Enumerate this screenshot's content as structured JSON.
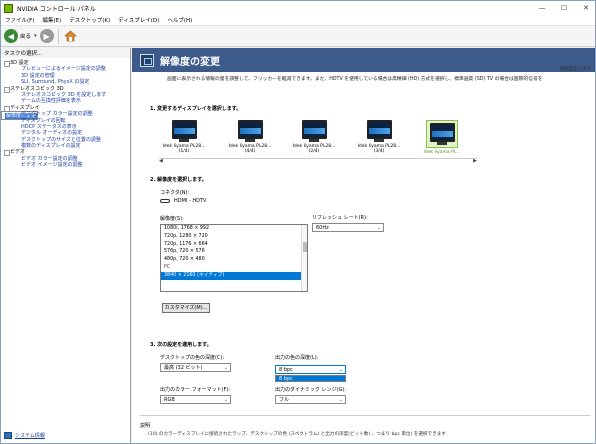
{
  "window": {
    "title": "NVIDIA コントロール パネル",
    "controls": [
      "—",
      "☐",
      "✕"
    ]
  },
  "menu": [
    "ファイル(F)",
    "編集(E)",
    "デスクトップ(K)",
    "ディスプレイ(D)",
    "ヘルプ(H)"
  ],
  "toolbar": {
    "back_label": "戻る"
  },
  "sidebar": {
    "header": "タスクの選択...",
    "categories": [
      {
        "label": "3D 設定",
        "items": [
          "プレビューによるイメージ設定の調整",
          "3D 設定の管理",
          "SLI, Surround, PhysX の設定"
        ]
      },
      {
        "label": "ステレオスコピック 3D",
        "items": [
          "ステレオスコピック 3D を設定します",
          "ゲームの互換性評価を表示"
        ]
      },
      {
        "label": "ディスプレイ",
        "items": [
          "解像度の変更",
          "デスクトップ カラー設定の調整",
          "ディスプレイの回転",
          "HDCP ステータスの表示",
          "デジタル オーディオの設定",
          "デスクトップのサイズと位置の調整",
          "複数のディスプレイの設定"
        ]
      },
      {
        "label": "ビデオ",
        "items": [
          "ビデオ カラー設定の調整",
          "ビデオ イメージ設定の調整"
        ]
      }
    ],
    "selected": "解像度の変更",
    "system_info": "システム情報"
  },
  "page": {
    "title": "解像度の変更",
    "restore": "初期設定に戻す",
    "description": "画面に表示される情報の量を調整して、フリッカーを軽減できます。また、HDTV を使用している場合は高精細 (HD) 方式を選択し、標準画質 (SD) TV の場合は国際的信号を",
    "step1": "1. 変更するディスプレイを選択します。",
    "monitors": [
      "Idek Iiyama PL28...\n(1/4)",
      "Idek Iiyama PL28...\n(4/4)",
      "Idek Iiyama PL28...\n(2/4)",
      "Idek Iiyama PL28...\n(3/4)",
      "Idek Iiyama PL..."
    ],
    "step2": "2. 解像度を選択します。",
    "connector_label": "コネクタ(N):",
    "connector_value": "HDMI - HDTV",
    "resolution_label": "解像度(S):",
    "resolutions": [
      "1080i, 1768 × 992",
      "720p, 1280 × 720",
      "720p, 1176 × 664",
      "576p, 720 × 576",
      "480p, 720 × 480",
      "PC",
      "3840 × 2160 (ネイティブ)"
    ],
    "refresh_label": "リフレッシュ レート(R):",
    "refresh_value": "60Hz",
    "customize_btn": "カスタマイズ(M)...",
    "step3": "3. 次の設定を適用します。",
    "desktop_depth_label": "デスクトップの色の深度(C):",
    "desktop_depth_value": "最高 (32 ビット)",
    "output_depth_label": "出力の色の深度(L):",
    "output_depth_value": "8 bpc",
    "output_depth_popup": "8 bpc",
    "output_format_label": "出力のカラー フォーマット(F):",
    "output_format_value": "RGB",
    "dynamic_range_label": "出力のダイナミック レンジ(G):",
    "dynamic_range_value": "フル",
    "bottom_title": "説明",
    "bottom_text": "(10) のカラーディスプレイに接続されたラップ、デスクトップの色 (スペクトラム) と出力の深度(ビット数) 、つまり bpc 単位) を選択できます"
  }
}
